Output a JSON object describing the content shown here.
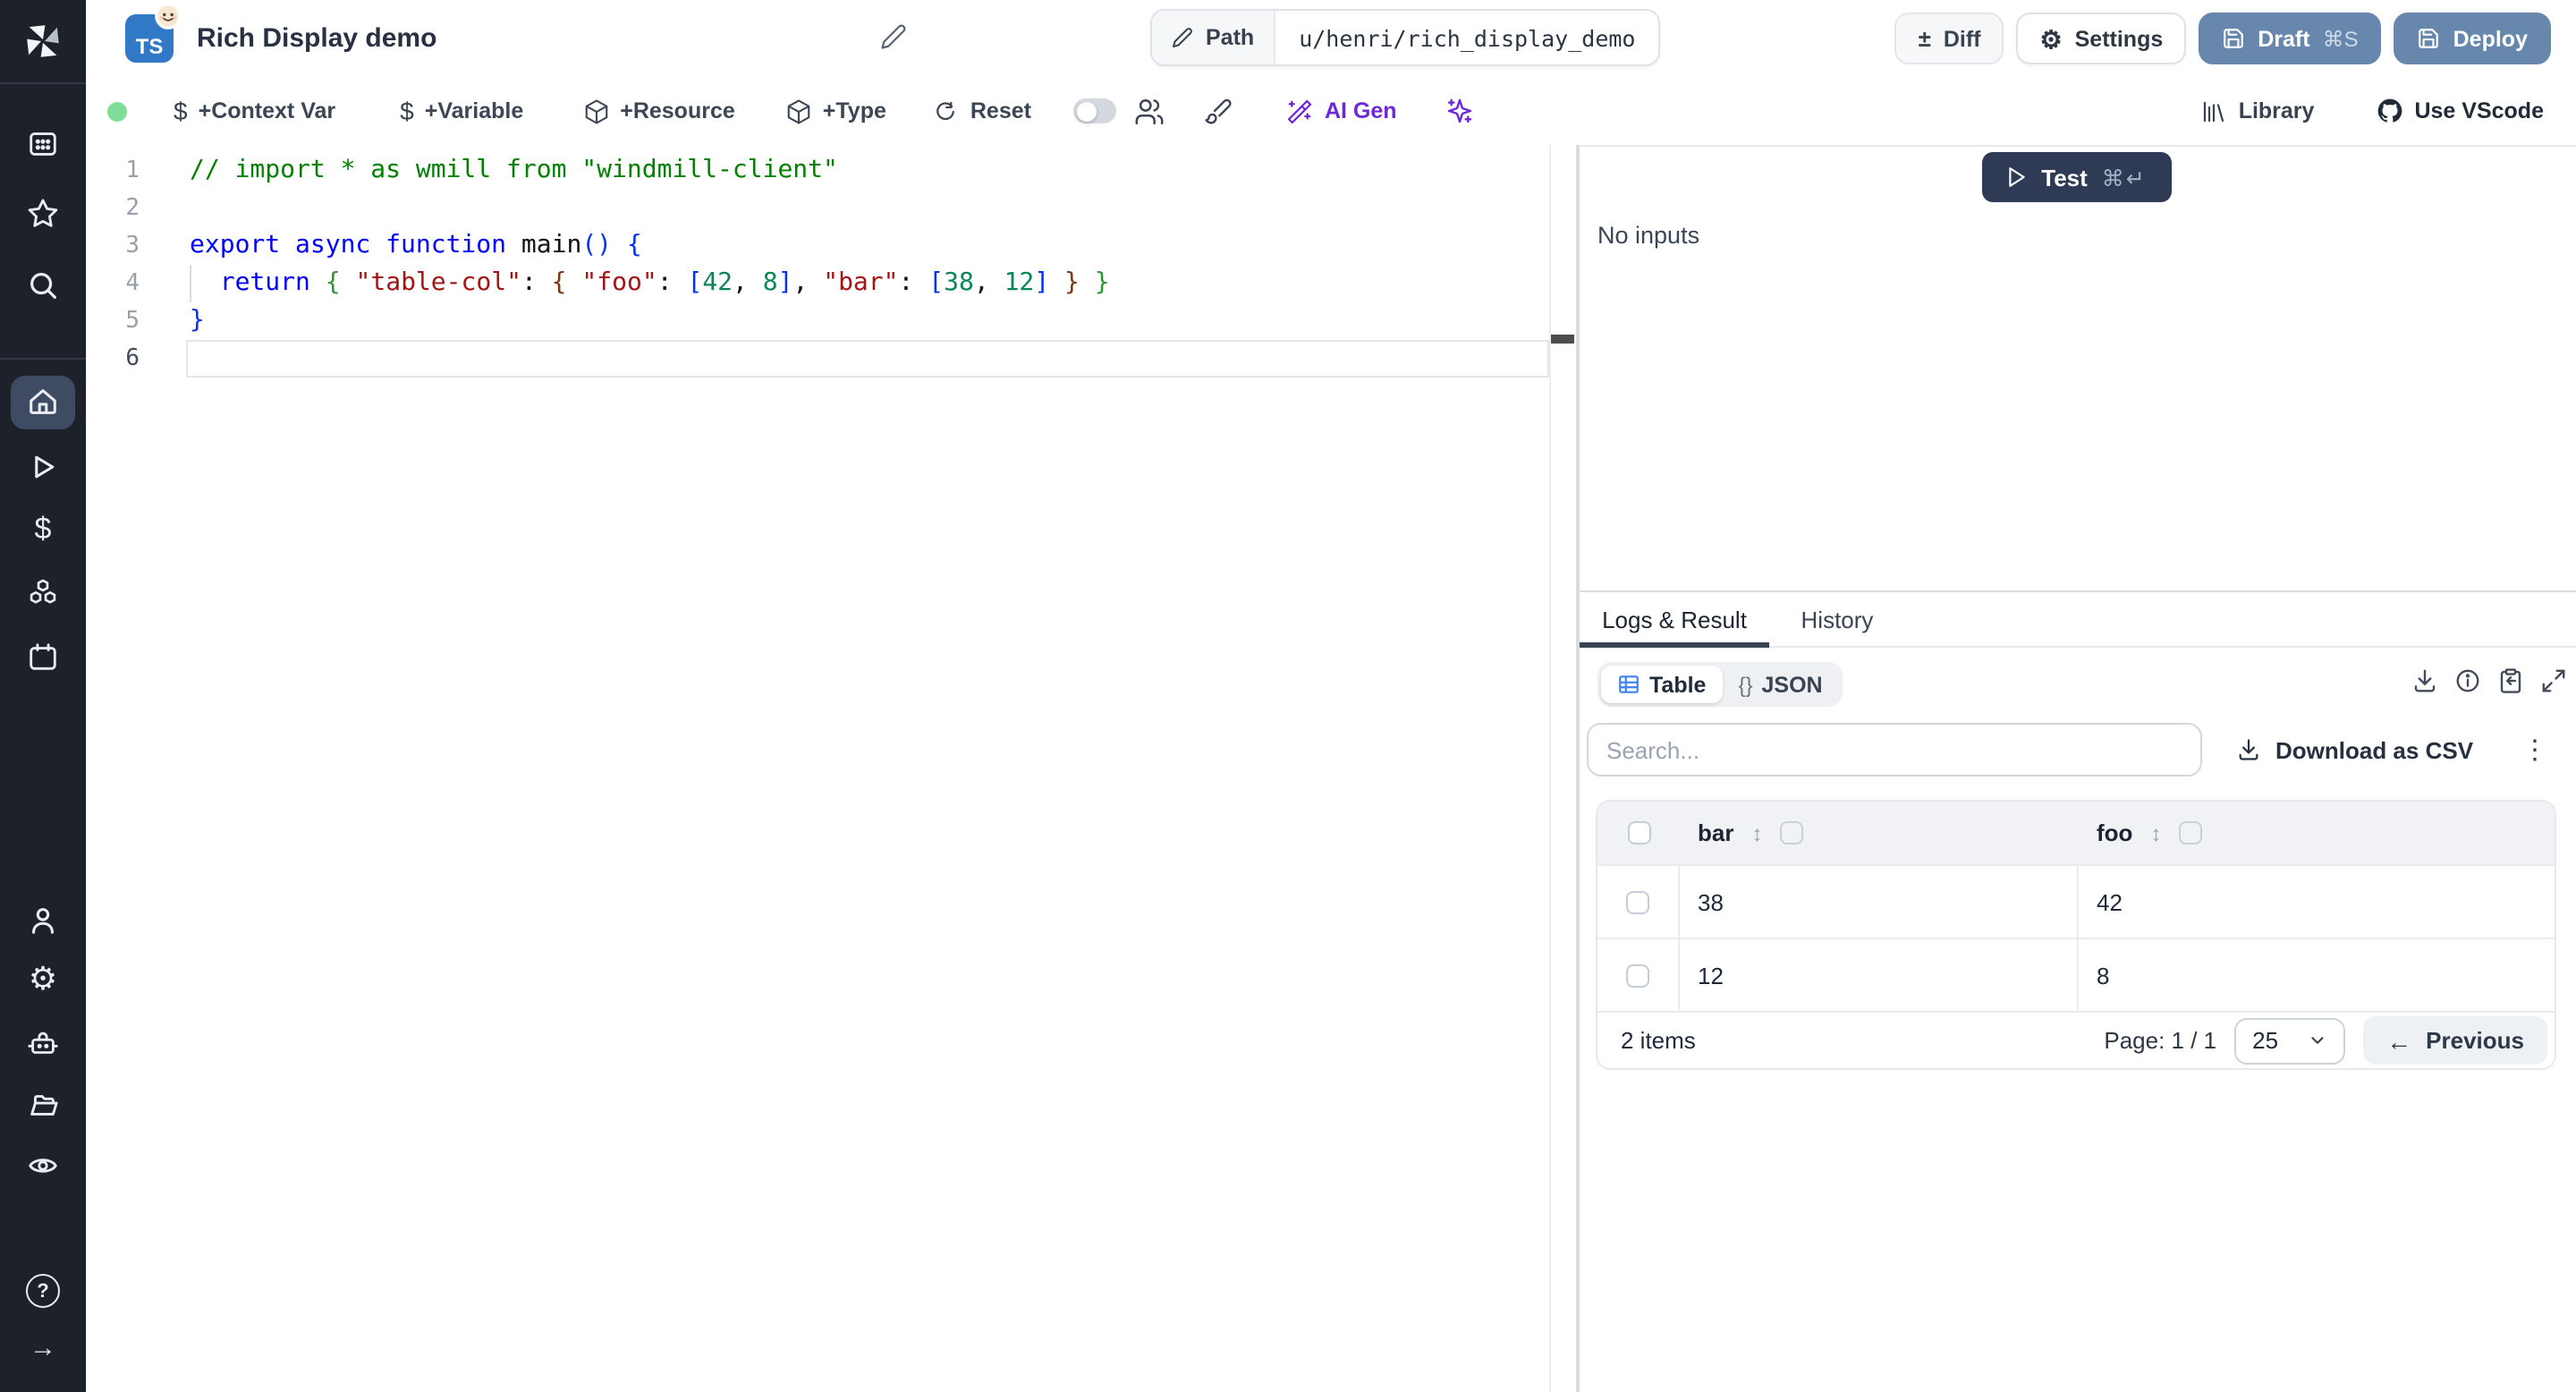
{
  "header": {
    "title": "Rich Display demo",
    "language_badge": "TS",
    "path": {
      "label": "Path",
      "value": "u/henri/rich_display_demo"
    },
    "diff_label": "Diff",
    "settings_label": "Settings",
    "draft_label": "Draft",
    "draft_shortcut": "⌘S",
    "deploy_label": "Deploy"
  },
  "toolbar": {
    "context_var": "+Context Var",
    "variable": "+Variable",
    "resource": "+Resource",
    "type": "+Type",
    "reset": "Reset",
    "ai_gen": "AI Gen",
    "library": "Library",
    "use_vscode": "Use VScode"
  },
  "editor": {
    "lines": [
      {
        "num": "1",
        "tokens": [
          [
            "comment",
            "// import * as wmill from \"windmill-client\""
          ]
        ]
      },
      {
        "num": "2",
        "tokens": []
      },
      {
        "num": "3",
        "tokens": [
          [
            "keyword",
            "export async function "
          ],
          [
            "plain",
            "main"
          ],
          [
            "bracket1",
            "() {"
          ]
        ]
      },
      {
        "num": "4",
        "tokens": [
          [
            "plain",
            "  "
          ],
          [
            "keyword",
            "return"
          ],
          [
            "plain",
            " "
          ],
          [
            "bracket2",
            "{"
          ],
          [
            "plain",
            " "
          ],
          [
            "string",
            "\"table-col\""
          ],
          [
            "plain",
            ": "
          ],
          [
            "bracket3",
            "{"
          ],
          [
            "plain",
            " "
          ],
          [
            "string",
            "\"foo\""
          ],
          [
            "plain",
            ": "
          ],
          [
            "bracket1",
            "["
          ],
          [
            "number",
            "42"
          ],
          [
            "plain",
            ", "
          ],
          [
            "number",
            "8"
          ],
          [
            "bracket1",
            "]"
          ],
          [
            "plain",
            ", "
          ],
          [
            "string",
            "\"bar\""
          ],
          [
            "plain",
            ": "
          ],
          [
            "bracket1",
            "["
          ],
          [
            "number",
            "38"
          ],
          [
            "plain",
            ", "
          ],
          [
            "number",
            "12"
          ],
          [
            "bracket1",
            "]"
          ],
          [
            "plain",
            " "
          ],
          [
            "bracket3",
            "}"
          ],
          [
            "plain",
            " "
          ],
          [
            "bracket2",
            "}"
          ]
        ]
      },
      {
        "num": "5",
        "tokens": [
          [
            "bracket1",
            "}"
          ]
        ]
      },
      {
        "num": "6",
        "tokens": [],
        "current": true
      }
    ]
  },
  "run_panel": {
    "test_label": "Test",
    "shortcut": "⌘↵",
    "no_inputs": "No inputs"
  },
  "result_panel": {
    "tabs": {
      "logs_result": "Logs & Result",
      "history": "History"
    },
    "view_toggle": {
      "table_label": "Table",
      "json_glyph": "{}",
      "json_label": "JSON"
    },
    "search_placeholder": "Search...",
    "download_csv_label": "Download as CSV",
    "table": {
      "columns": [
        "bar",
        "foo"
      ],
      "rows": [
        [
          "38",
          "42"
        ],
        [
          "12",
          "8"
        ]
      ],
      "items_count": "2 items",
      "page_label": "Page: 1 / 1",
      "page_size": "25",
      "previous_label": "Previous"
    }
  },
  "icons_glyphs": {
    "plusminus": "±",
    "gear": "⚙",
    "dollar": "$",
    "kebab": "⋮",
    "sort": "↕",
    "arrow_left": "←",
    "arrow_right": "→",
    "question": "?"
  },
  "colors": {
    "accent_slate": "#6787ad",
    "test_button": "#2f3b54",
    "ai_violet": "#6d28d9",
    "table_icon_blue": "#3b82f6",
    "status_green": "#7fdd9a",
    "sidebar_bg": "#1d212a"
  }
}
